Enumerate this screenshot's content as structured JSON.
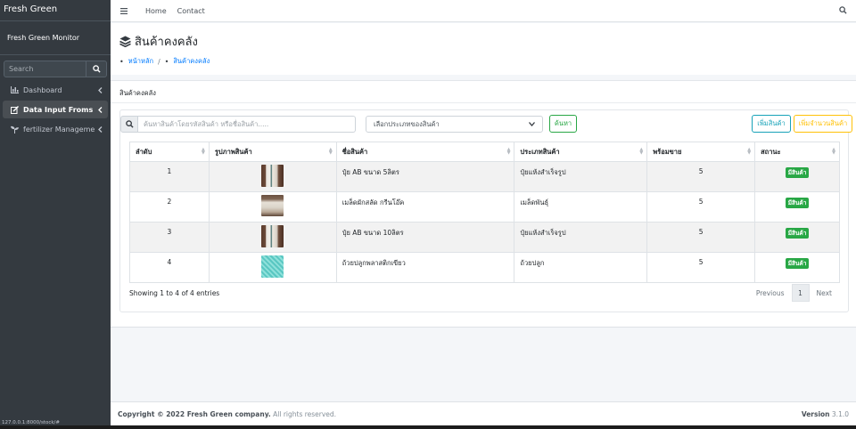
{
  "sidebar": {
    "brand": "Fresh Green",
    "user": "Fresh Green Monitor",
    "search_placeholder": "Search",
    "items": [
      {
        "label": "Dashboard",
        "icon": "dashboard-icon"
      },
      {
        "label": "Data Input Froms",
        "icon": "edit-icon"
      },
      {
        "label": "fertilizer Management",
        "icon": "seedling-icon"
      }
    ],
    "status_url": "127.0.0.1:8000/stock/#"
  },
  "topbar": {
    "links": [
      "Home",
      "Contact"
    ]
  },
  "header": {
    "title": "สินค้าคงคลัง",
    "breadcrumb": [
      "หน้าหลัก",
      "สินค้าคงคลัง"
    ]
  },
  "card": {
    "title": "สินค้าคงคลัง",
    "search_placeholder": "ค้นหาสินค้าโดยรหัสสินค้า หรือชื่อสินค้า.....",
    "type_select": "เลือกประเภทของสินค้า",
    "search_button": "ค้นหา",
    "add_button": "เพิ่มสินค้า",
    "add_qty_button": "เพิ่มจำนวนสินค้า",
    "columns": [
      "ลำดับ",
      "รูปภาพสินค้า",
      "ชื่อสินค้า",
      "ประเภทสินค้า",
      "พร้อมขาย",
      "สถานะ"
    ],
    "rows": [
      {
        "no": "1",
        "thumb": "bottle",
        "name": "ปุ๋ย AB ขนาด 5ลิตร",
        "type": "ปุ๋ยแห้งสำเร็จรูป",
        "ready": "5",
        "status": "มีสินค้า"
      },
      {
        "no": "2",
        "thumb": "seeds",
        "name": "เมล็ดผักสลัด กรีนโอ๊ค",
        "type": "เมล็ดพันธุ์",
        "ready": "5",
        "status": "มีสินค้า"
      },
      {
        "no": "3",
        "thumb": "bottle",
        "name": "ปุ๋ย AB ขนาด 10ลิตร",
        "type": "ปุ๋ยแห้งสำเร็จรูป",
        "ready": "5",
        "status": "มีสินค้า"
      },
      {
        "no": "4",
        "thumb": "tray",
        "name": "ถ้วยปลูกพลาสติกเขียว",
        "type": "ถ้วยปลูก",
        "ready": "5",
        "status": "มีสินค้า"
      }
    ],
    "info": "Showing 1 to 4 of 4 entries",
    "pager": {
      "prev": "Previous",
      "current": "1",
      "next": "Next"
    }
  },
  "footer": {
    "copyright_prefix": "Copyright © 2022 ",
    "company": "Fresh Green company.",
    "rights": " All rights reserved.",
    "version_label": "Version",
    "version": " 3.1.0"
  },
  "colors": {
    "sidebar_bg": "#343a40",
    "link_blue": "#007bff",
    "success": "#28a745",
    "info": "#17a2b8",
    "warning": "#ffc107"
  }
}
